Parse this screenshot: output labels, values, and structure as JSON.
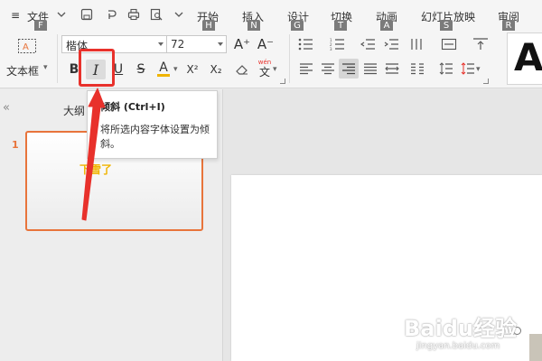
{
  "menubar": {
    "hamburger": "≡",
    "file_menu": "文件",
    "tabs": [
      {
        "label": "开始",
        "keytip": "H"
      },
      {
        "label": "插入",
        "keytip": "N"
      },
      {
        "label": "设计",
        "keytip": "G"
      },
      {
        "label": "切换",
        "keytip": "T"
      },
      {
        "label": "动画",
        "keytip": "A"
      },
      {
        "label": "幻灯片放映",
        "keytip": "S"
      },
      {
        "label": "审阅",
        "keytip": "R"
      }
    ],
    "file_keytip": "F"
  },
  "ribbon": {
    "textbox_label": "文本框",
    "font_name": "楷体",
    "font_size": "72",
    "bold": "B",
    "italic": "I",
    "underline": "U",
    "strike": "S",
    "font_color": "A",
    "superscript": "X²",
    "subscript": "X₂",
    "phonetic": "wén",
    "phonetic_char": "文",
    "grow_font": "A⁺",
    "shrink_font": "A⁻",
    "style_preview": "A",
    "highlight_color": "#f0b400"
  },
  "leftpane": {
    "collapse_icon": "«",
    "outline_label": "大纲",
    "slide_number": "1",
    "slide_text": "下雪了",
    "slide_text_color": "#f0b400"
  },
  "tooltip": {
    "title": "倾斜 (Ctrl+I)",
    "description": "将所选内容字体设置为倾斜。"
  },
  "annotation": {
    "color": "#e8312b"
  },
  "watermark": {
    "brand": "Baidu经验",
    "url": "jingyan.baidu.com"
  }
}
